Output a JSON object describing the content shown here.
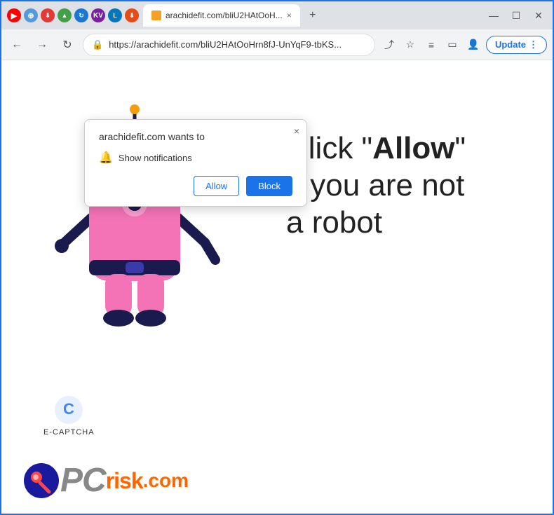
{
  "browser": {
    "tabs": [
      {
        "label": "arachidefit.com/bliU2HAtOoH...",
        "active": true
      }
    ],
    "address": "https://arachidefit.com/bliU2HAtOoHrn8fJ-UnYqF9-tbKS...",
    "update_button": "Update"
  },
  "popup": {
    "title": "arachidefit.com wants to",
    "permission": "Show notifications",
    "allow": "Allow",
    "block": "Block",
    "close": "×"
  },
  "page": {
    "click_text_line1": "Click \"",
    "click_text_allow": "Allow",
    "click_text_line1_end": "\"",
    "click_text_line2": "if you are not",
    "click_text_line3": "a robot",
    "ecaptcha_label": "E-CAPTCHA",
    "pcrisk_pc": "PC",
    "pcrisk_risk": "risk",
    "pcrisk_com": ".com"
  },
  "icons": {
    "back": "←",
    "forward": "→",
    "refresh": "↻",
    "lock": "🔒",
    "share": "⤴",
    "bookmark": "☆",
    "menu_ext": "≡",
    "cast": "▭",
    "profile": "👤",
    "more_vert": "⋮",
    "bell": "🔔",
    "close": "×",
    "chevron_down": "⌄"
  }
}
